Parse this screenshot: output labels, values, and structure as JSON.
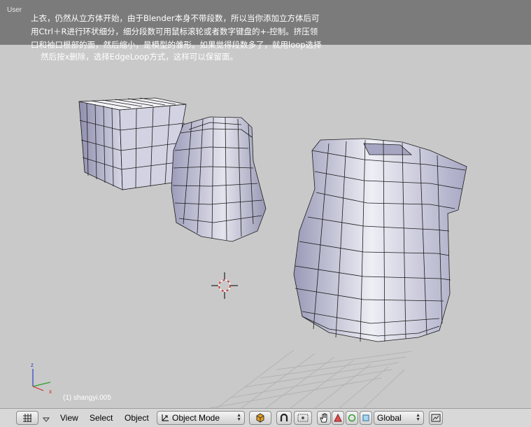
{
  "viewport": {
    "view_label": "User",
    "caption_lines": [
      "上衣，仍然从立方体开始，由于Blender本身不带段数，所以当你添加立方体后可",
      "用Ctrl＋R进行环状细分，细分段数可用鼠标滚轮或者数字键盘的+-控制。挤压领",
      "口和袖口根部的面，然后缩小，是模型的雏形。如果觉得段数多了，就用loop选择",
      "然后按x删除，选择EdgeLoop方式，这样可以保留面。"
    ],
    "object_label": "(1) shangyi.005"
  },
  "header": {
    "menus": [
      "View",
      "Select",
      "Object"
    ],
    "mode": "Object Mode",
    "orientation": "Global"
  },
  "colors": {
    "viewport_bg": "#c9c9c9",
    "header_bg": "#d8d8d8",
    "mesh_fill": "#b9b9cf",
    "mesh_wire": "#1a1a1a"
  },
  "icons": [
    "grid-icon",
    "triangle-down-icon",
    "cube-icon",
    "magnet-icon",
    "snap-icon",
    "hand-icon",
    "triangle-icon",
    "circle-icon",
    "square-icon",
    "render-icon"
  ]
}
